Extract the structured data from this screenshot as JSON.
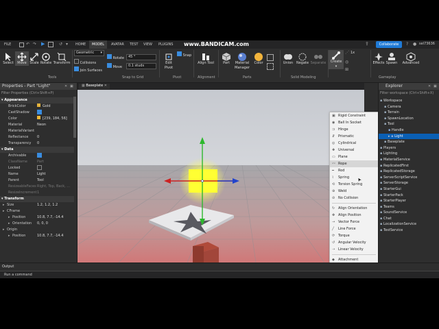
{
  "overlay": {
    "watermark": "www.BANDICAM.com"
  },
  "menu": {
    "file": "FILE",
    "tabs": [
      "HOME",
      "MODEL",
      "AVATAR",
      "TEST",
      "VIEW",
      "PLUGINS"
    ],
    "collaborate": "Collaborate",
    "user": "sel73636"
  },
  "ribbon": {
    "tools": [
      "Select",
      "Move",
      "Scale",
      "Rotate",
      "Transform"
    ],
    "tools_label": "Tools",
    "space_select": "Geometric",
    "collisions": "Collisions",
    "join_surfaces": "Join Surfaces",
    "rotate_label": "Rotate",
    "rotate_value": "45 °",
    "move_label": "Move",
    "move_value": "0.1 studs",
    "snap_label": "Snap to Grid",
    "edit_pivot": "Edit Pivot",
    "snap": "Snap",
    "pivot_label": "Pivot",
    "align_tool": "Align Tool",
    "alignment_label": "Alignment",
    "part": "Part",
    "material_manager": "Material Manager",
    "color": "Color",
    "parts_label": "Parts",
    "union": "Union",
    "negate": "Negate",
    "separate": "Separate",
    "solid_label": "Solid Modeling",
    "create": "Create",
    "effects": "Effects",
    "spawn": "Spawn",
    "advanced": "Advanced",
    "gameplay_label": "Gameplay",
    "scale_value": "1x"
  },
  "properties": {
    "title": "Properties - Part \"Light\"",
    "filter_placeholder": "Filter Properties (Ctrl+Shift+P)",
    "rows": [
      {
        "type": "section",
        "label": "Appearance"
      },
      {
        "label": "BrickColor",
        "value": "Gold",
        "swatch": "#e5b33c"
      },
      {
        "label": "CastShadow",
        "check": true
      },
      {
        "label": "Color",
        "value": "[239, 184, 56]",
        "swatch": "#efb838"
      },
      {
        "label": "Material",
        "value": "Neon"
      },
      {
        "label": "MaterialVariant",
        "value": ""
      },
      {
        "label": "Reflectance",
        "value": "0"
      },
      {
        "label": "Transparency",
        "value": "0"
      },
      {
        "type": "section",
        "label": "Data"
      },
      {
        "label": "Archivable",
        "check": true
      },
      {
        "label": "ClassName",
        "value": "Part",
        "dim": true
      },
      {
        "label": "Locked",
        "check": false
      },
      {
        "label": "Name",
        "value": "Light"
      },
      {
        "label": "Parent",
        "value": "Tool"
      },
      {
        "label": "ResizeableFaces",
        "value": "Right, Top, Back, ...",
        "dim": true
      },
      {
        "label": "ResizeIncrement",
        "value": "1",
        "dim": true
      },
      {
        "type": "section",
        "label": "Transform"
      },
      {
        "label": "Size",
        "value": "1.2, 1.2, 1.2",
        "expand": true
      },
      {
        "label": "CFrame",
        "value": "",
        "expand": true
      },
      {
        "label": "Position",
        "value": "10.8, 7.7, -14.4",
        "indent": true
      },
      {
        "label": "Orientation",
        "value": "0, 0, 0",
        "indent": true
      },
      {
        "label": "Origin",
        "value": "",
        "expand": true
      },
      {
        "label": "Position",
        "value": "10.8, 7.7, -14.4",
        "indent": true
      }
    ]
  },
  "viewport": {
    "tab": "Baseplate"
  },
  "create_menu": {
    "items": [
      "Rigid Constraint",
      "Ball In Socket",
      "Hinge",
      "Prismatic",
      "Cylindrical",
      "Universal",
      "Plane",
      "Rope",
      "Rod",
      "Spring",
      "Torsion Spring",
      "Weld",
      "No Collision",
      "Align Orientation",
      "Align Position",
      "Vector Force",
      "Line Force",
      "Torque",
      "Angular Velocity",
      "Linear Velocity",
      "Attachment"
    ],
    "highlighted": "Rope"
  },
  "explorer": {
    "title": "Explorer",
    "filter_placeholder": "Filter workspace (Ctrl+Shift+X)",
    "items": [
      {
        "label": "Workspace",
        "level": 0
      },
      {
        "label": "Camera",
        "level": 1
      },
      {
        "label": "Terrain",
        "level": 1
      },
      {
        "label": "SpawnLocation",
        "level": 1
      },
      {
        "label": "Tool",
        "level": 1
      },
      {
        "label": "Handle",
        "level": 2
      },
      {
        "label": "Light",
        "level": 2,
        "selected": true
      },
      {
        "label": "Baseplate",
        "level": 1
      },
      {
        "label": "Players",
        "level": 0
      },
      {
        "label": "Lighting",
        "level": 0
      },
      {
        "label": "MaterialService",
        "level": 0
      },
      {
        "label": "ReplicatedFirst",
        "level": 0
      },
      {
        "label": "ReplicatedStorage",
        "level": 0
      },
      {
        "label": "ServerScriptService",
        "level": 0
      },
      {
        "label": "ServerStorage",
        "level": 0
      },
      {
        "label": "StarterGui",
        "level": 0
      },
      {
        "label": "StarterPack",
        "level": 0
      },
      {
        "label": "StarterPlayer",
        "level": 0
      },
      {
        "label": "Teams",
        "level": 0
      },
      {
        "label": "SoundService",
        "level": 0
      },
      {
        "label": "Chat",
        "level": 0
      },
      {
        "label": "LocalizationService",
        "level": 0
      },
      {
        "label": "TestService",
        "level": 0
      }
    ]
  },
  "output": {
    "title": "Output",
    "command_placeholder": "Run a command"
  },
  "colors": {
    "accent": "#3a8de0",
    "collaborate": "#1f7ad6",
    "selected": "#0a5fb4",
    "neon": "#ffff33"
  }
}
